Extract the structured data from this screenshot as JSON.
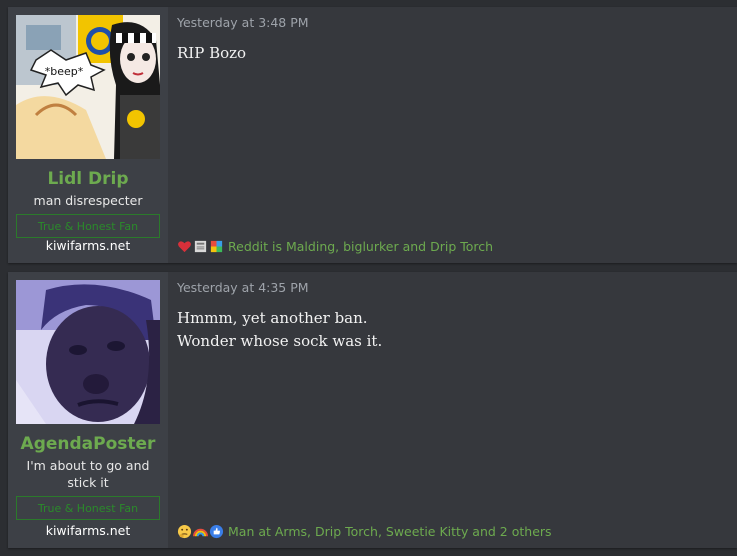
{
  "posts": [
    {
      "username": "Lidl Drip",
      "user_title": "man disrespecter",
      "banner": "True & Honest Fan",
      "site": "kiwifarms.net",
      "avatar_caption": "*beep*",
      "timestamp": "Yesterday at 3:48 PM",
      "body_lines": [
        "RIP Bozo"
      ],
      "reaction_icons": [
        "heart-icon",
        "newspaper-icon",
        "puzzle-icon"
      ],
      "reactions_text": "Reddit is Malding, biglurker and Drip Torch"
    },
    {
      "username": "AgendaPoster",
      "user_title": "I'm about to go and stick it",
      "banner": "True & Honest Fan",
      "site": "kiwifarms.net",
      "timestamp": "Yesterday at 4:35 PM",
      "body_lines": [
        "Hmmm, yet another ban.",
        "Wonder whose sock was it."
      ],
      "reaction_icons": [
        "thinking-face-icon",
        "rainbow-icon",
        "thumbs-up-icon"
      ],
      "reactions_text": "Man at Arms, Drip Torch, Sweetie Kitty and 2 others"
    }
  ]
}
